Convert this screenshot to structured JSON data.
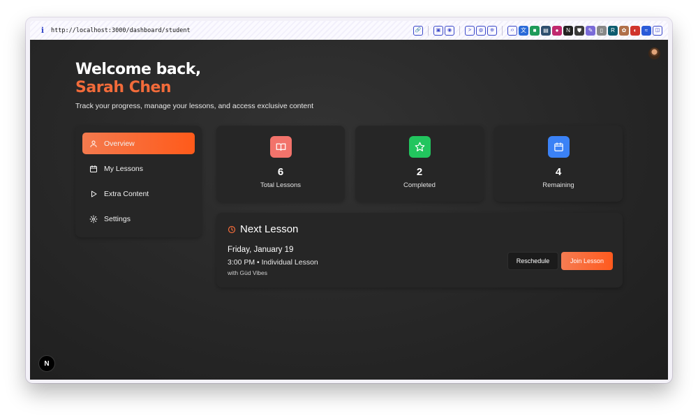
{
  "browser": {
    "url": "http://localhost:3000/dashboard/student",
    "info_icon": "i",
    "extensions": [
      {
        "name": "link-icon",
        "glyph": "🔗",
        "color": "#3a48c9"
      },
      {
        "name": "screen-icon",
        "glyph": "▣",
        "color": "#3a48c9"
      },
      {
        "name": "camera-icon",
        "glyph": "◉",
        "color": "#3a48c9"
      },
      {
        "name": "terminal-icon",
        "glyph": ">",
        "color": "#3a48c9"
      },
      {
        "name": "globe-icon",
        "glyph": "◍",
        "color": "#3a48c9"
      },
      {
        "name": "crosshair-icon",
        "glyph": "⊕",
        "color": "#3a48c9"
      },
      {
        "name": "code-icon",
        "glyph": "‹›",
        "color": "#3a48c9"
      },
      {
        "name": "translate-icon",
        "glyph": "文",
        "color": "#2a6ad8"
      },
      {
        "name": "green-extension-icon",
        "glyph": "■",
        "color": "#1e9a5a"
      },
      {
        "name": "picture-icon",
        "glyph": "▤",
        "color": "#2f4f6f"
      },
      {
        "name": "pink-extension-icon",
        "glyph": "●",
        "color": "#c0286e"
      },
      {
        "name": "notion-icon",
        "glyph": "N",
        "color": "#222222"
      },
      {
        "name": "shield-extension-icon",
        "glyph": "⛊",
        "color": "#3a3a3a"
      },
      {
        "name": "feather-icon",
        "glyph": "✎",
        "color": "#7a6ad8"
      },
      {
        "name": "doc-icon",
        "glyph": "▯",
        "color": "#888888"
      },
      {
        "name": "r-extension-icon",
        "glyph": "R",
        "color": "#0c5b6f"
      },
      {
        "name": "cookie-icon",
        "glyph": "✿",
        "color": "#b0704a"
      },
      {
        "name": "color-extension-icon",
        "glyph": "◐",
        "color": "#d0342c"
      },
      {
        "name": "wave-icon",
        "glyph": "≈",
        "color": "#2a5ad8"
      },
      {
        "name": "sidebar-toggle-icon",
        "glyph": "◫",
        "color": "#3a48c9"
      }
    ]
  },
  "header": {
    "greeting": "Welcome back,",
    "name": "Sarah Chen",
    "subtitle": "Track your progress, manage your lessons, and access exclusive content"
  },
  "sidebar": {
    "items": [
      {
        "label": "Overview",
        "icon": "user-icon",
        "active": true
      },
      {
        "label": "My Lessons",
        "icon": "calendar-icon",
        "active": false
      },
      {
        "label": "Extra Content",
        "icon": "play-icon",
        "active": false
      },
      {
        "label": "Settings",
        "icon": "gear-icon",
        "active": false
      }
    ]
  },
  "stats": [
    {
      "value": "6",
      "label": "Total Lessons",
      "icon": "book-icon",
      "color": "#f2736b"
    },
    {
      "value": "2",
      "label": "Completed",
      "icon": "star-icon",
      "color": "#22c55e"
    },
    {
      "value": "4",
      "label": "Remaining",
      "icon": "calendar-icon",
      "color": "#3b82f6"
    }
  ],
  "next_lesson": {
    "title": "Next Lesson",
    "date": "Friday, January 19",
    "time": "3:00 PM • Individual Lesson",
    "with": "with Güd Vibes",
    "reschedule_label": "Reschedule",
    "join_label": "Join Lesson"
  },
  "badge": "N",
  "colors": {
    "accent": "#ff5a1a",
    "name_color": "#f26b3a",
    "card_bg": "#262626"
  }
}
